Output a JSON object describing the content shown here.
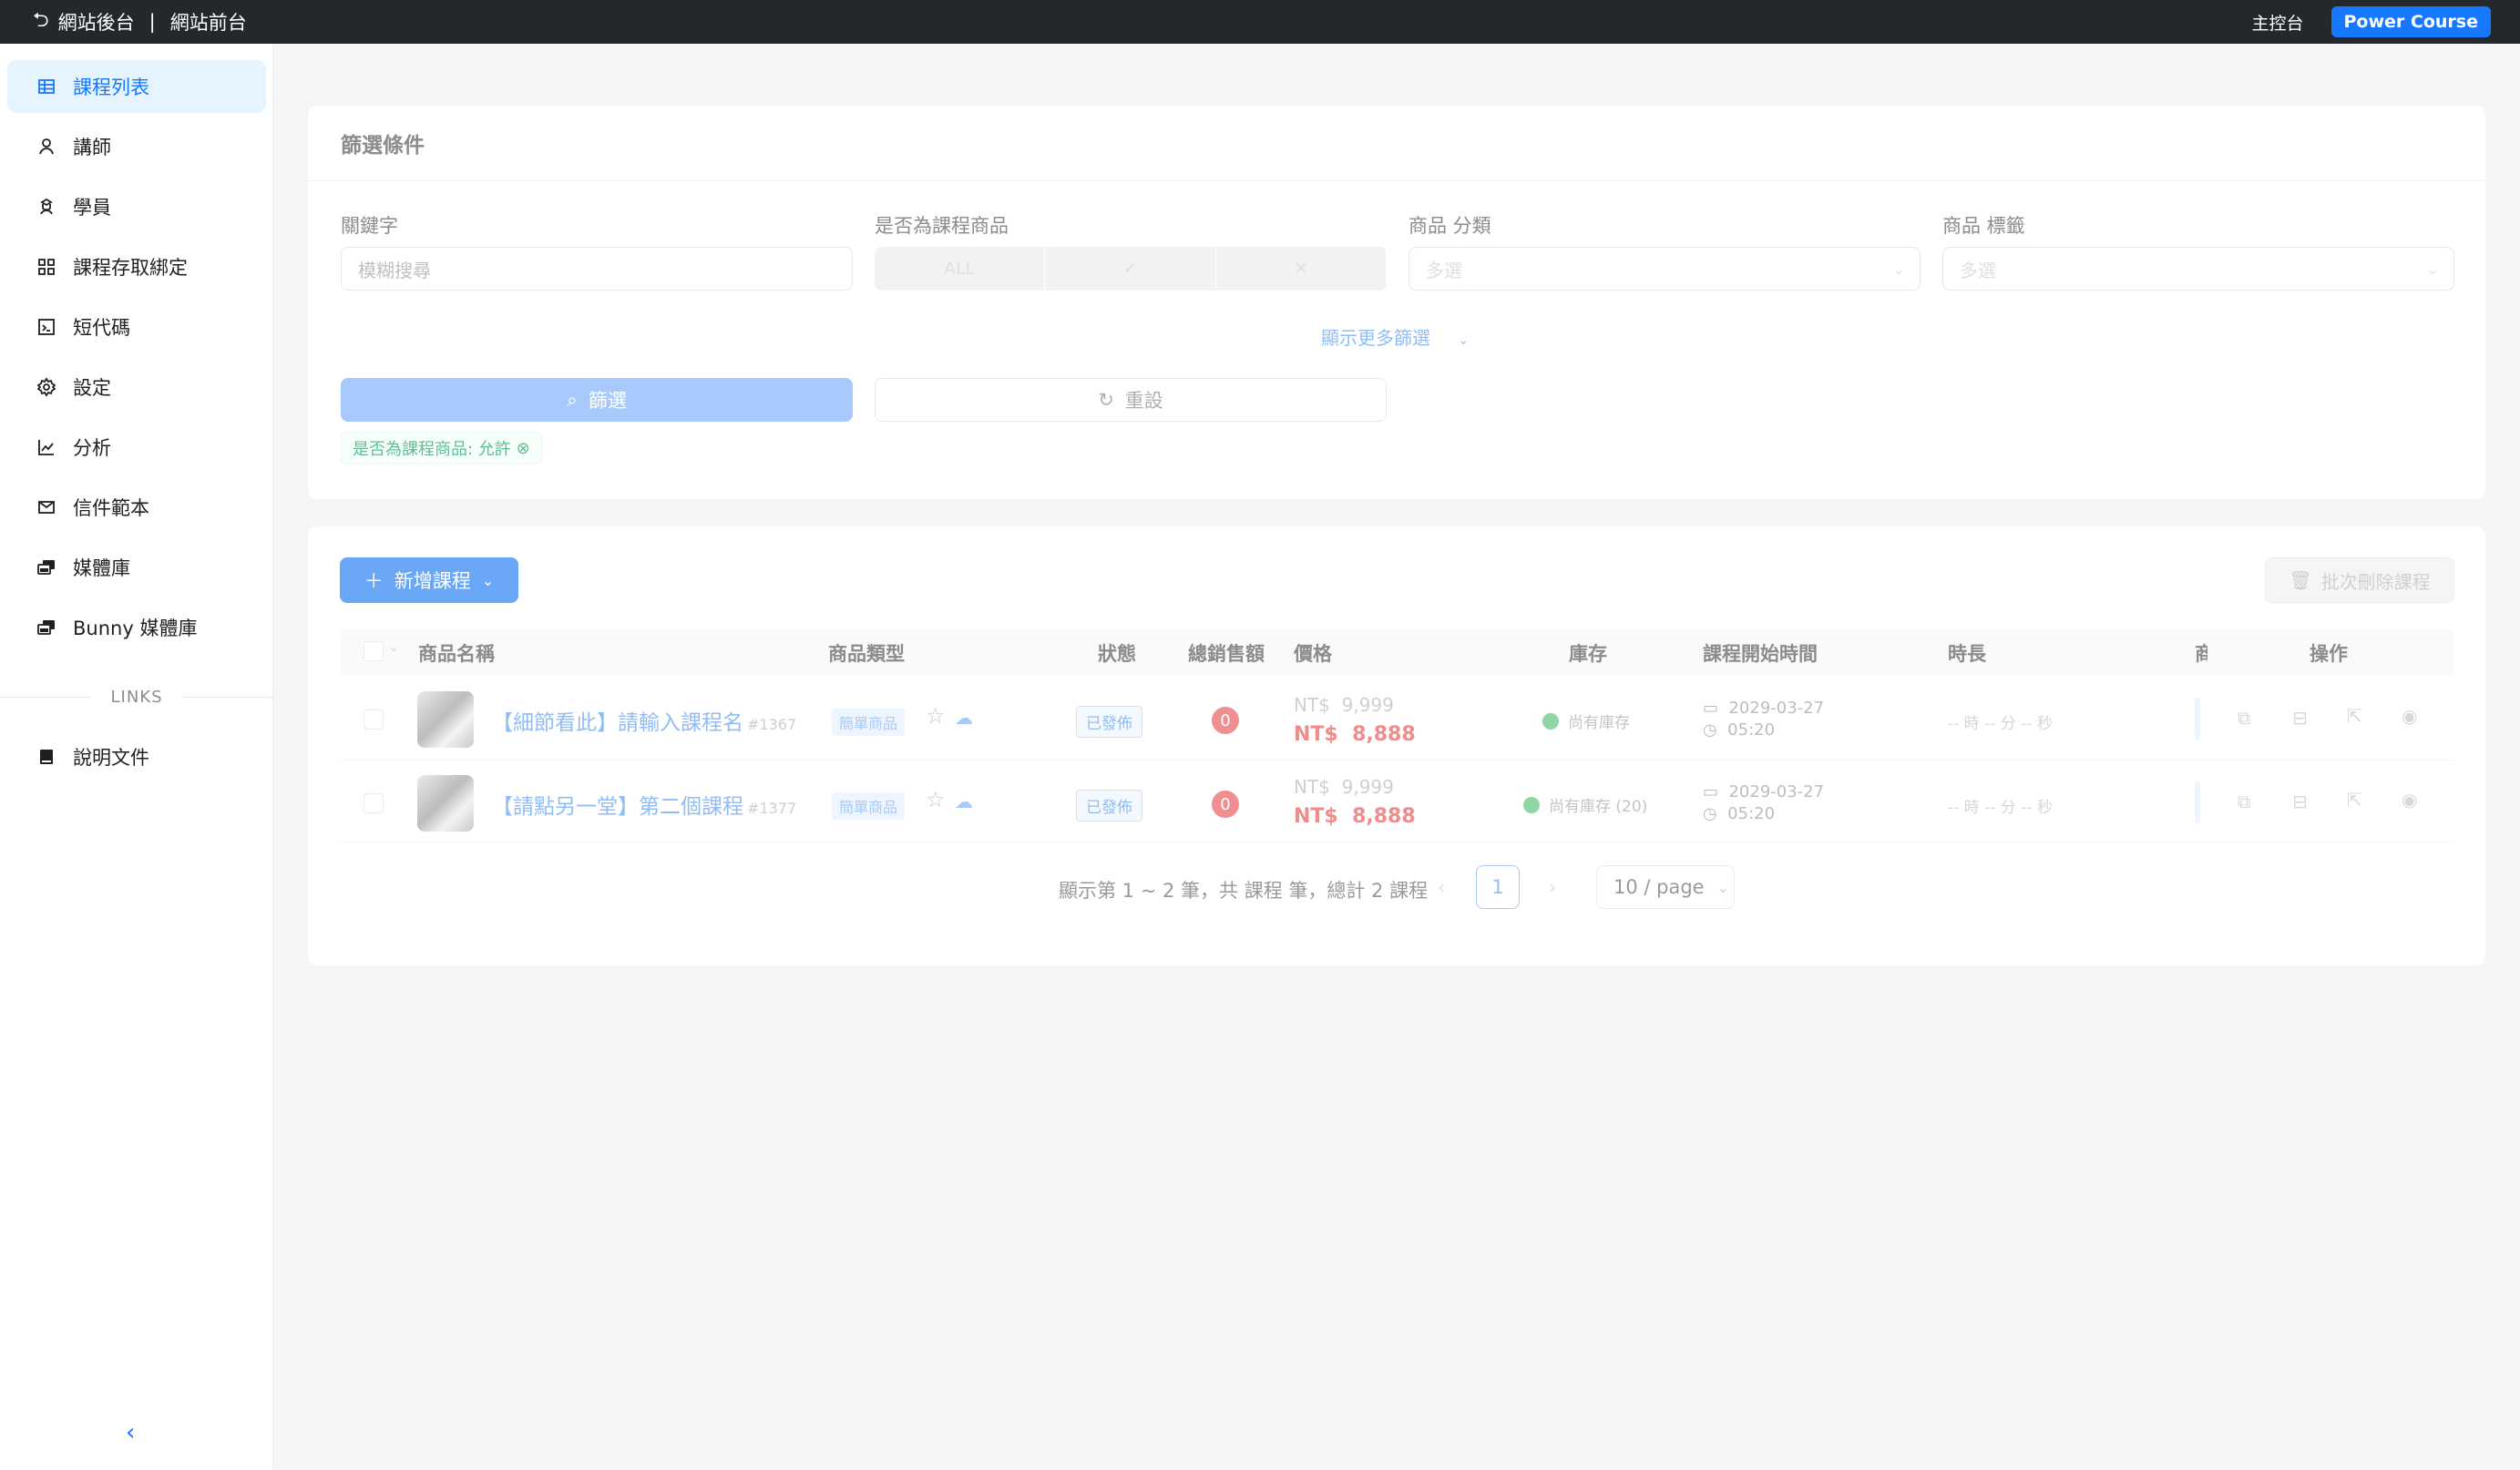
{
  "topbar": {
    "back_icon": "undo-icon",
    "backend": "網站後台",
    "separator": "|",
    "frontend": "網站前台",
    "dashboard": "主控台",
    "brand": "Power Course",
    "brand_color": "#1677ff"
  },
  "sidebar": {
    "items": [
      {
        "label": "課程列表",
        "icon": "table-icon"
      },
      {
        "label": "講師",
        "icon": "user-icon"
      },
      {
        "label": "學員",
        "icon": "student-icon"
      },
      {
        "label": "課程存取綁定",
        "icon": "grid-icon"
      },
      {
        "label": "短代碼",
        "icon": "code-icon"
      },
      {
        "label": "設定",
        "icon": "gear-icon"
      },
      {
        "label": "分析",
        "icon": "chart-icon"
      },
      {
        "label": "信件範本",
        "icon": "mail-icon"
      },
      {
        "label": "媒體庫",
        "icon": "media-icon"
      },
      {
        "label": "Bunny 媒體庫",
        "icon": "media-icon"
      }
    ],
    "links_heading": "LINKS",
    "links": [
      {
        "label": "說明文件",
        "icon": "book-icon"
      }
    ],
    "collapse": "‹"
  },
  "filter": {
    "title": "篩選條件",
    "keyword_label": "關鍵字",
    "keyword_placeholder": "模糊搜尋",
    "is_course_label": "是否為課程商品",
    "is_course_options": [
      "ALL",
      "✓",
      "✕"
    ],
    "category_label": "商品 分類",
    "category_placeholder": "多選",
    "tag_label": "商品 標籤",
    "tag_placeholder": "多選",
    "more": "顯示更多篩選",
    "submit": "篩選",
    "reset": "重設",
    "active_tag": "是否為課程商品: 允許"
  },
  "table": {
    "add_button": "新增課程",
    "bulk_delete": "批次刪除課程",
    "columns": [
      "商品名稱",
      "商品類型",
      "狀態",
      "總銷售額",
      "價格",
      "庫存",
      "課程開始時間",
      "時長",
      "商",
      "操作"
    ],
    "rows": [
      {
        "name": "【細節看此】請輸入課程名",
        "id": "#1367",
        "type": "簡單商品",
        "status": "已發佈",
        "sales": "0",
        "price_currency": "NT$",
        "regular_price": "9,999",
        "sale_price": "8,888",
        "stock": "尚有庫存",
        "date": "2029-03-27",
        "time": "05:20",
        "duration": "-- 時 -- 分 -- 秒"
      },
      {
        "name": "【請點另一堂】第二個課程",
        "id": "#1377",
        "type": "簡單商品",
        "status": "已發佈",
        "sales": "0",
        "price_currency": "NT$",
        "regular_price": "9,999",
        "sale_price": "8,888",
        "stock": "尚有庫存 (20)",
        "date": "2029-03-27",
        "time": "05:20",
        "duration": "-- 時 -- 分 -- 秒"
      }
    ]
  },
  "pagination": {
    "summary": "顯示第 1 ~ 2 筆，共 課程 筆，總計 2 課程",
    "current": "1",
    "prev": "‹",
    "next": "›",
    "page_size": "10 / page"
  }
}
